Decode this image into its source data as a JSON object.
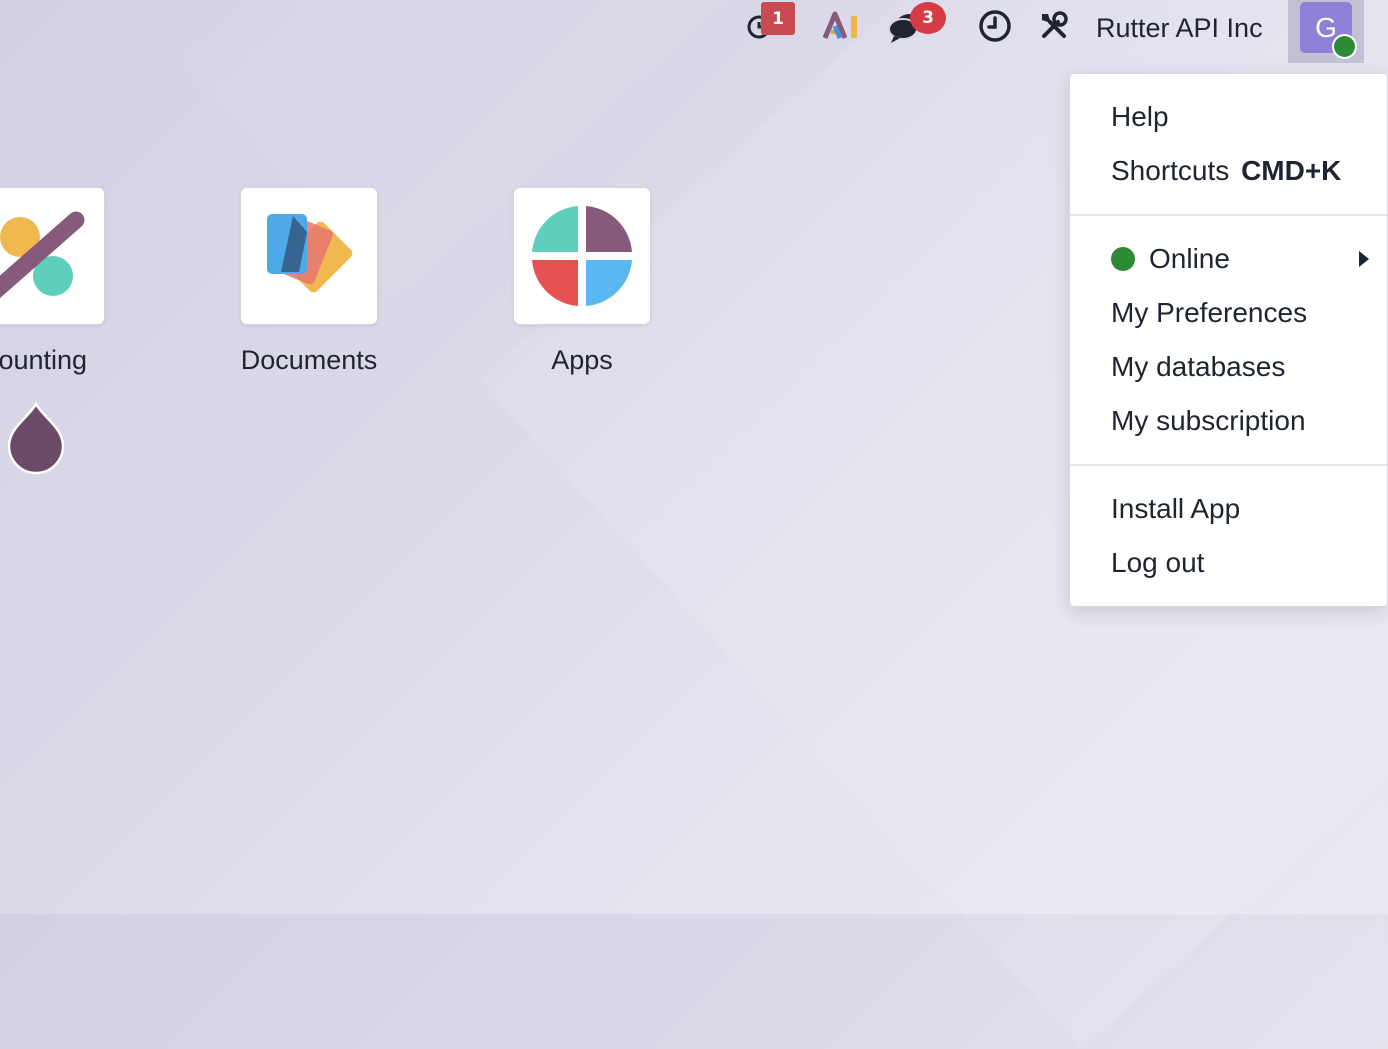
{
  "navbar": {
    "activity_badge": "1",
    "messages_badge": "3",
    "company_name": "Rutter API Inc",
    "avatar_initial": "G"
  },
  "apps": [
    {
      "label": "counting"
    },
    {
      "label": "Documents"
    },
    {
      "label": "Apps"
    }
  ],
  "user_menu": {
    "help": "Help",
    "shortcuts_label": "Shortcuts",
    "shortcuts_key": "CMD+K",
    "status": "Online",
    "preferences": "My Preferences",
    "databases": "My databases",
    "subscription": "My subscription",
    "install_app": "Install App",
    "logout": "Log out"
  },
  "colors": {
    "online": "#2e8a35",
    "badge_red": "#d53c45",
    "avatar_bg": "#8e80d8",
    "brand_purple": "#875a7b"
  }
}
